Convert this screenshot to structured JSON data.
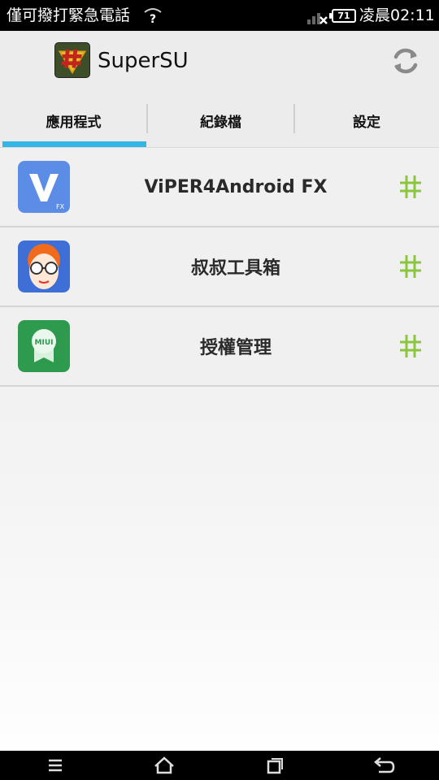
{
  "status_bar": {
    "carrier_text": "僅可撥打緊急電話",
    "battery_level": "71",
    "time": "凌晨02:11"
  },
  "action_bar": {
    "title": "SuperSU"
  },
  "tabs": [
    {
      "label": "應用程式",
      "selected": true
    },
    {
      "label": "紀錄檔",
      "selected": false
    },
    {
      "label": "設定",
      "selected": false
    }
  ],
  "apps": [
    {
      "name": "ViPER4Android FX",
      "icon": "viper4android-fx-icon",
      "icon_badge": "FX"
    },
    {
      "name": "叔叔工具箱",
      "icon": "uncle-toolbox-icon"
    },
    {
      "name": "授權管理",
      "icon": "miui-permission-manager-icon",
      "icon_badge": "MIUI"
    }
  ],
  "colors": {
    "tab_indicator": "#33b5e5",
    "grant_hash": "#8cc63f"
  }
}
